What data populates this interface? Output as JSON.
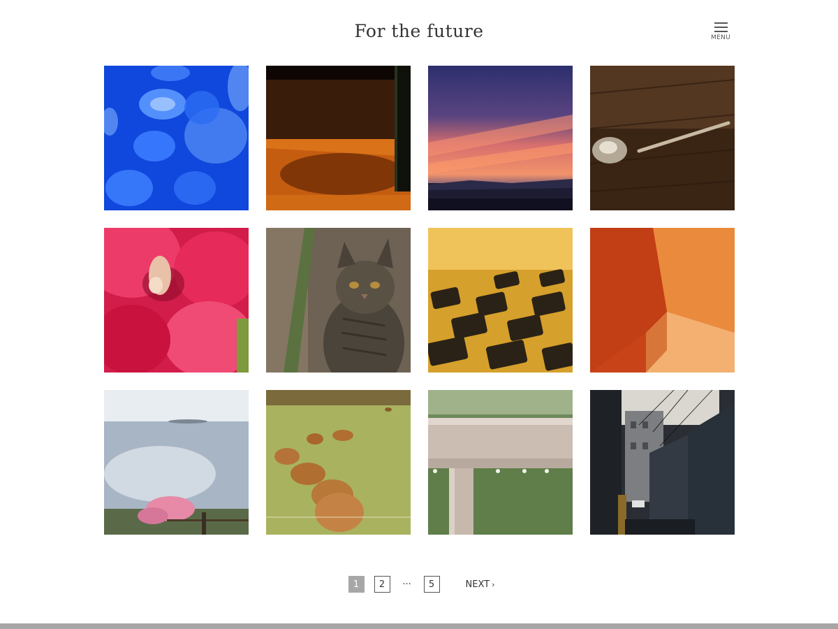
{
  "header": {
    "site_title": "For the future",
    "menu_label": "MENU",
    "menu_icon": "hamburger-icon"
  },
  "gallery": {
    "items": [
      {
        "subject": "jellyfish"
      },
      {
        "subject": "table-bottle-shadow"
      },
      {
        "subject": "sunset-sky"
      },
      {
        "subject": "spoon-on-wood"
      },
      {
        "subject": "red-hibiscus"
      },
      {
        "subject": "tabby-cat"
      },
      {
        "subject": "keyboard-closeup"
      },
      {
        "subject": "orange-room-corner"
      },
      {
        "subject": "sea-view-blossoms"
      },
      {
        "subject": "cows-on-grass"
      },
      {
        "subject": "rainy-railing"
      },
      {
        "subject": "narrow-alley"
      }
    ]
  },
  "pagination": {
    "pages": [
      "1",
      "2",
      "···",
      "5"
    ],
    "current": "1",
    "next_label": "NEXT",
    "next_icon": "chevron-right-icon"
  },
  "colors": {
    "footer_bar": "#a6a6a6",
    "current_page_bg": "#a7a7a7"
  }
}
